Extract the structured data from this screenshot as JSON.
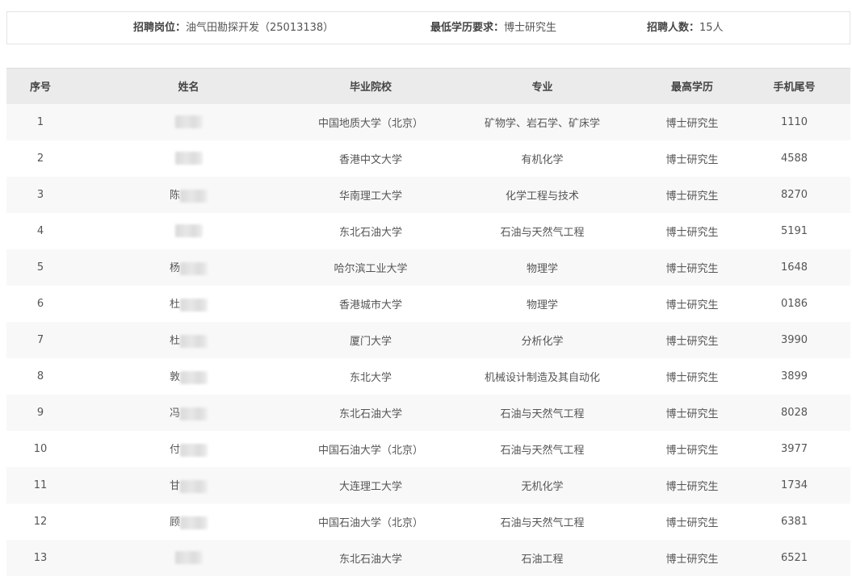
{
  "info": {
    "position_label": "招聘岗位：",
    "position_value": "油气田勘探开发（25013138）",
    "edu_label": "最低学历要求：",
    "edu_value": "博士研究生",
    "count_label": "招聘人数：",
    "count_value": "15人"
  },
  "table": {
    "headers": [
      "序号",
      "姓名",
      "毕业院校",
      "专业",
      "最高学历",
      "手机尾号"
    ],
    "rows": [
      {
        "no": "1",
        "name": "",
        "school": "中国地质大学（北京）",
        "major": "矿物学、岩石学、矿床学",
        "degree": "博士研究生",
        "phone": "1110"
      },
      {
        "no": "2",
        "name": "",
        "school": "香港中文大学",
        "major": "有机化学",
        "degree": "博士研究生",
        "phone": "4588"
      },
      {
        "no": "3",
        "name": "陈",
        "school": "华南理工大学",
        "major": "化学工程与技术",
        "degree": "博士研究生",
        "phone": "8270"
      },
      {
        "no": "4",
        "name": "",
        "school": "东北石油大学",
        "major": "石油与天然气工程",
        "degree": "博士研究生",
        "phone": "5191"
      },
      {
        "no": "5",
        "name": "杨",
        "school": "哈尔滨工业大学",
        "major": "物理学",
        "degree": "博士研究生",
        "phone": "1648"
      },
      {
        "no": "6",
        "name": "杜",
        "school": "香港城市大学",
        "major": "物理学",
        "degree": "博士研究生",
        "phone": "0186"
      },
      {
        "no": "7",
        "name": "杜",
        "school": "厦门大学",
        "major": "分析化学",
        "degree": "博士研究生",
        "phone": "3990"
      },
      {
        "no": "8",
        "name": "敦",
        "school": "东北大学",
        "major": "机械设计制造及其自动化",
        "degree": "博士研究生",
        "phone": "3899"
      },
      {
        "no": "9",
        "name": "冯",
        "school": "东北石油大学",
        "major": "石油与天然气工程",
        "degree": "博士研究生",
        "phone": "8028"
      },
      {
        "no": "10",
        "name": "付",
        "school": "中国石油大学（北京）",
        "major": "石油与天然气工程",
        "degree": "博士研究生",
        "phone": "3977"
      },
      {
        "no": "11",
        "name": "甘",
        "school": "大连理工大学",
        "major": "无机化学",
        "degree": "博士研究生",
        "phone": "1734"
      },
      {
        "no": "12",
        "name": "顾",
        "school": "中国石油大学（北京）",
        "major": "石油与天然气工程",
        "degree": "博士研究生",
        "phone": "6381"
      },
      {
        "no": "13",
        "name": "",
        "school": "东北石油大学",
        "major": "石油工程",
        "degree": "博士研究生",
        "phone": "6521"
      }
    ]
  }
}
